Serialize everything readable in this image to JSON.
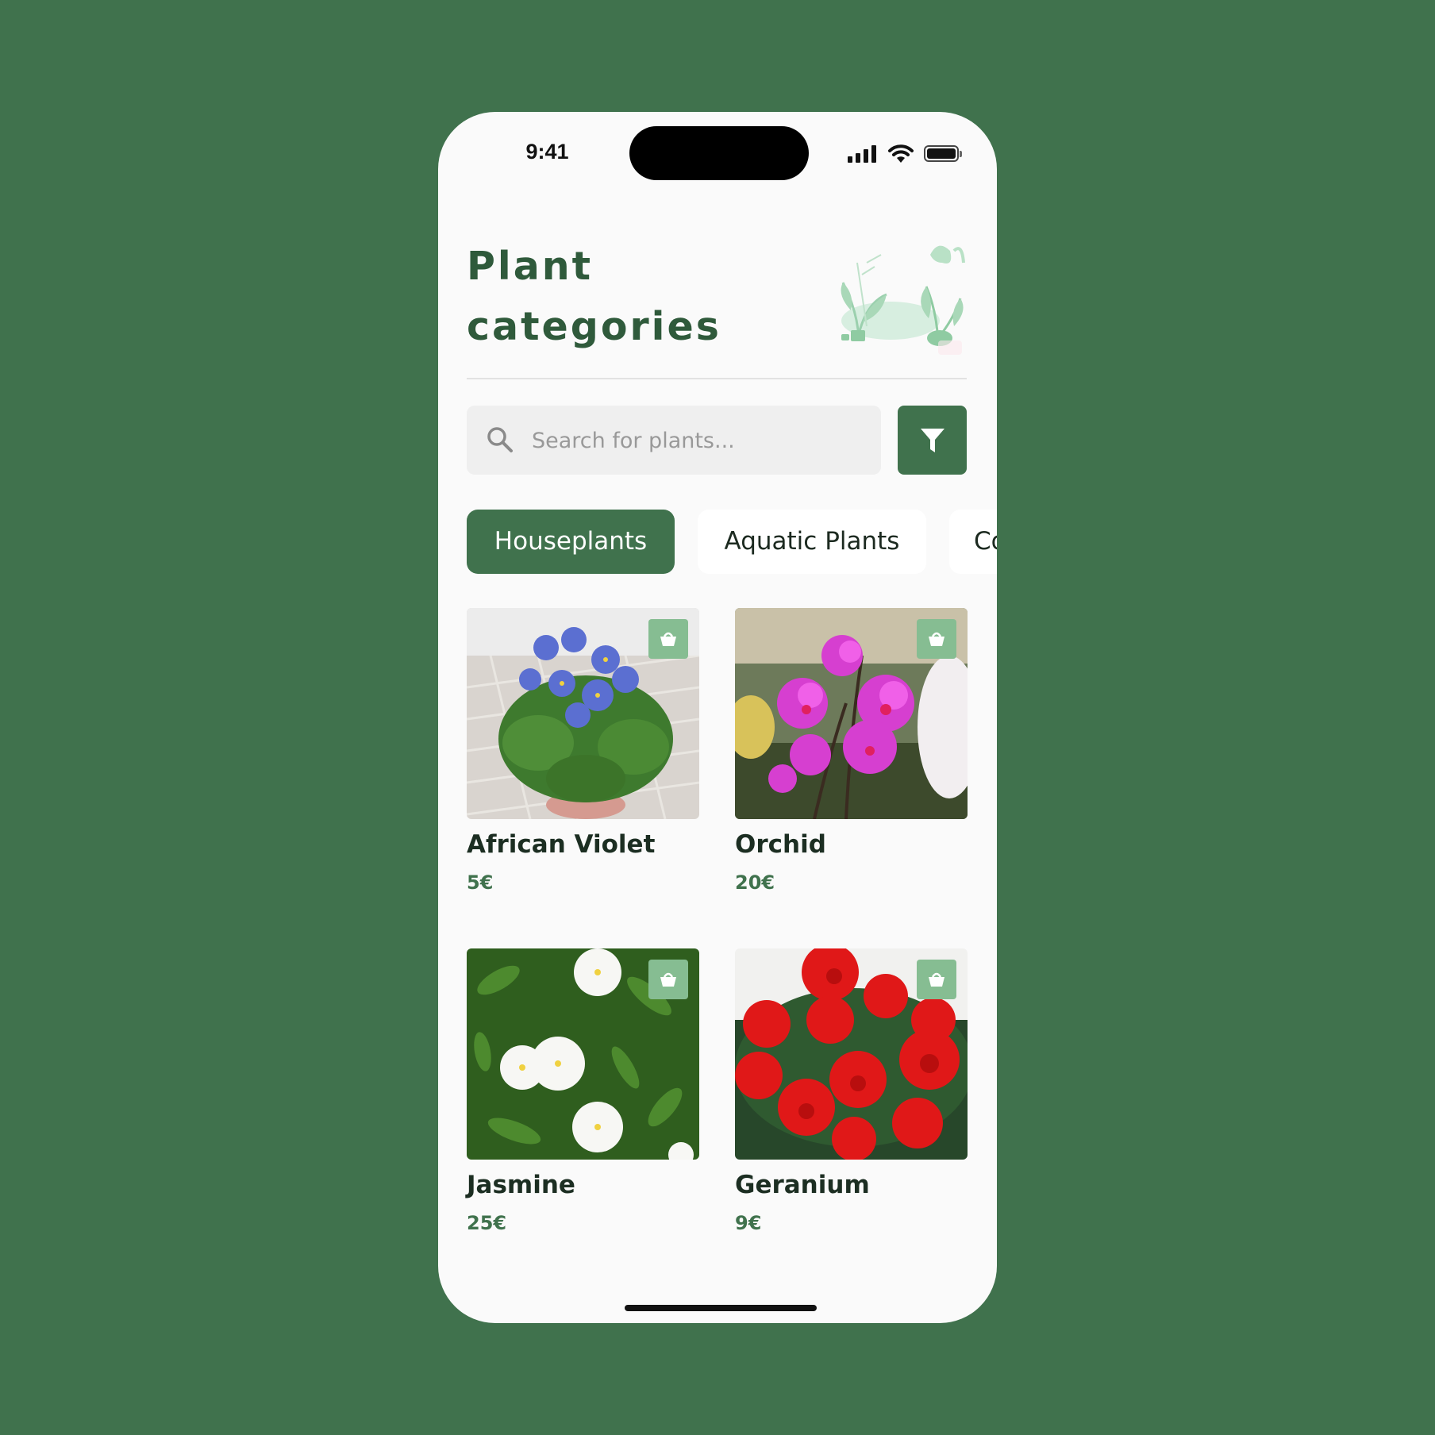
{
  "status_bar": {
    "time": "9:41"
  },
  "header": {
    "title": "Plant categories"
  },
  "search": {
    "placeholder": "Search for plants..."
  },
  "categories": [
    {
      "label": "Houseplants",
      "active": true
    },
    {
      "label": "Aquatic Plants",
      "active": false
    },
    {
      "label": "Co",
      "active": false
    }
  ],
  "products": [
    {
      "name": "African Violet",
      "price": "5€",
      "image": "purple-violet-flowers"
    },
    {
      "name": "Orchid",
      "price": "20€",
      "image": "magenta-orchid-flowers"
    },
    {
      "name": "Jasmine",
      "price": "25€",
      "image": "white-jasmine-flowers"
    },
    {
      "name": "Geranium",
      "price": "9€",
      "image": "red-geranium-flowers"
    }
  ],
  "colors": {
    "background": "#40724d",
    "accent": "#40724d",
    "title": "#2f5a3b",
    "basket": "#86bd92",
    "surface": "#fafafa"
  }
}
